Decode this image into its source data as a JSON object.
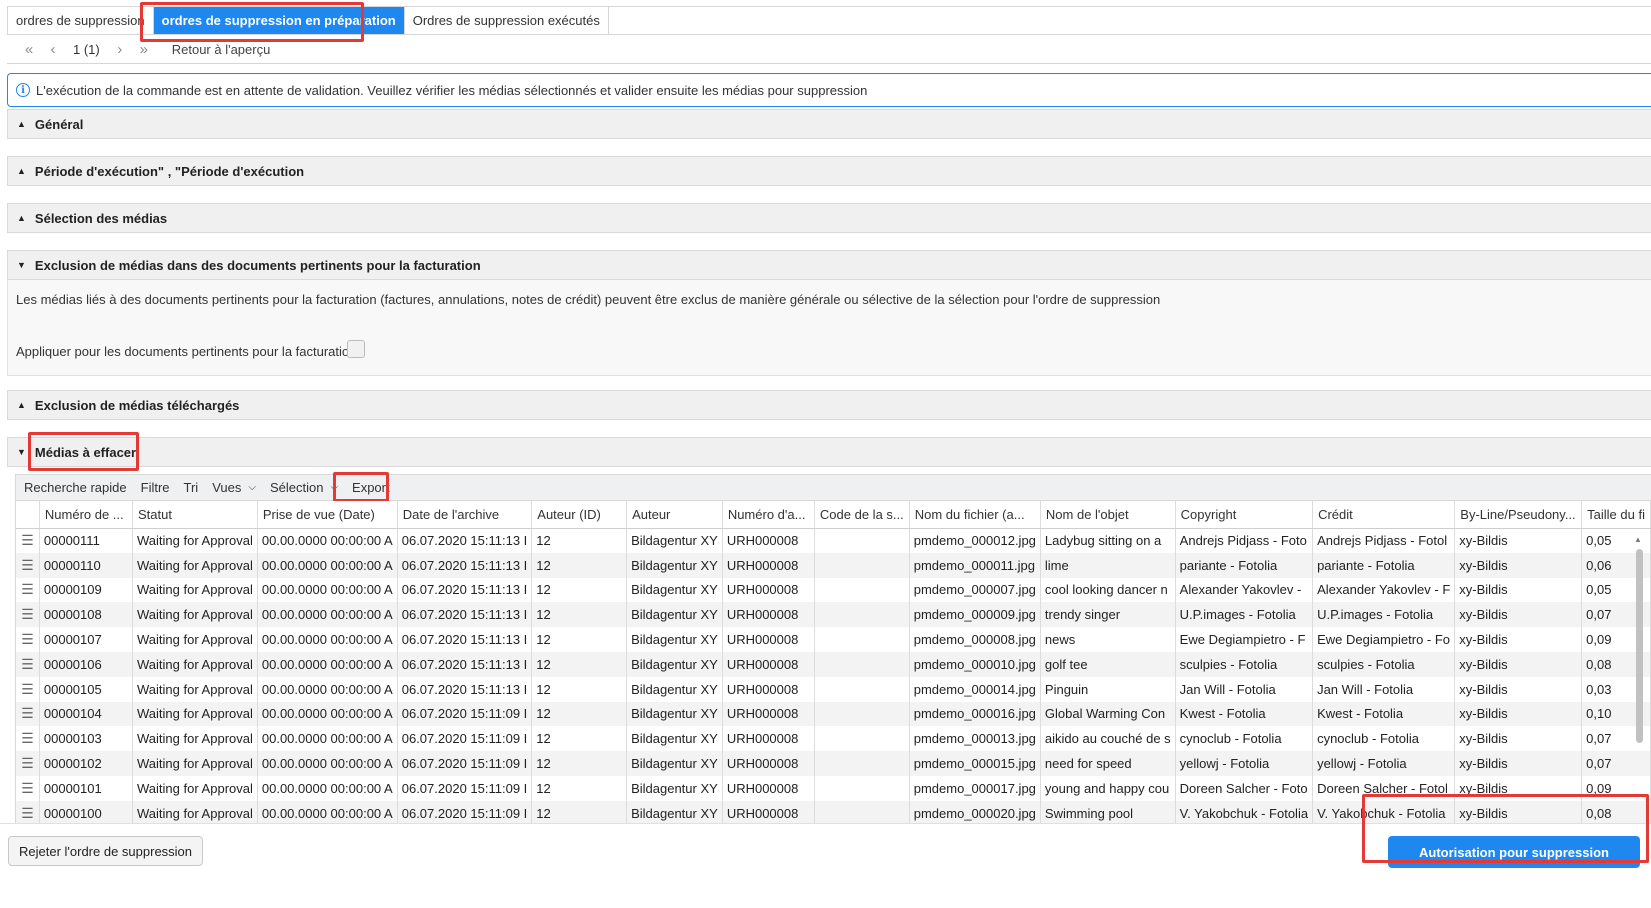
{
  "tabs": [
    {
      "label": "ordres de suppression"
    },
    {
      "label": "ordres de suppression en préparation"
    },
    {
      "label": "Ordres de suppression exécutés"
    }
  ],
  "pager": {
    "page": "1 (1)",
    "back": "Retour à l'aperçu"
  },
  "info": {
    "icon": "info-icon",
    "text": "L'exécution de la commande est en attente de validation. Veuillez vérifier les médias sélectionnés et valider ensuite les médias pour suppression"
  },
  "sections": {
    "general": "Général",
    "periode": "Période d'exécution\" , \"Période d'exécution",
    "selection": "Sélection des médias",
    "exclusion_billing": "Exclusion de médias dans des documents pertinents pour la facturation",
    "exclusion_downloaded": "Exclusion de médias téléchargés",
    "to_delete": "Médias à effacer"
  },
  "exclusion": {
    "description": "Les médias liés à des documents pertinents pour la facturation (factures, annulations, notes de crédit) peuvent être exclus de manière générale ou sélective de la sélection pour l'ordre de suppression",
    "apply_label": "Appliquer pour les documents pertinents pour la facturation:"
  },
  "toolbar": {
    "quick_search": "Recherche rapide",
    "filter": "Filtre",
    "sort": "Tri",
    "views": "Vues",
    "selection": "Sélection",
    "export": "Export"
  },
  "table": {
    "columns": [
      "",
      "Numéro de ...",
      "Statut",
      "Prise de vue (Date)",
      "Date de l'archive",
      "Auteur (ID)",
      "Auteur",
      "Numéro d'a...",
      "Code de la s...",
      "Nom du fichier (a...",
      "Nom de l'objet",
      "Copyright",
      "Crédit",
      "By-Line/Pseudony...",
      "Taille du fi"
    ],
    "rows": [
      [
        "☰",
        "00000111",
        "Waiting for Approval",
        "00.00.0000 00:00:00 A",
        "06.07.2020 15:11:13 I",
        "12",
        "Bildagentur XY",
        "URH000008",
        "",
        "pmdemo_000012.jpg",
        "Ladybug sitting on a",
        "Andrejs Pidjass - Foto",
        "Andrejs Pidjass - Fotol",
        "xy-Bildis",
        "0,05"
      ],
      [
        "☰",
        "00000110",
        "Waiting for Approval",
        "00.00.0000 00:00:00 A",
        "06.07.2020 15:11:13 I",
        "12",
        "Bildagentur XY",
        "URH000008",
        "",
        "pmdemo_000011.jpg",
        "lime",
        "pariante - Fotolia",
        "pariante - Fotolia",
        "xy-Bildis",
        "0,06"
      ],
      [
        "☰",
        "00000109",
        "Waiting for Approval",
        "00.00.0000 00:00:00 A",
        "06.07.2020 15:11:13 I",
        "12",
        "Bildagentur XY",
        "URH000008",
        "",
        "pmdemo_000007.jpg",
        "cool looking dancer n",
        "Alexander Yakovlev -",
        "Alexander Yakovlev - F",
        "xy-Bildis",
        "0,05"
      ],
      [
        "☰",
        "00000108",
        "Waiting for Approval",
        "00.00.0000 00:00:00 A",
        "06.07.2020 15:11:13 I",
        "12",
        "Bildagentur XY",
        "URH000008",
        "",
        "pmdemo_000009.jpg",
        "trendy singer",
        "U.P.images - Fotolia",
        "U.P.images - Fotolia",
        "xy-Bildis",
        "0,07"
      ],
      [
        "☰",
        "00000107",
        "Waiting for Approval",
        "00.00.0000 00:00:00 A",
        "06.07.2020 15:11:13 I",
        "12",
        "Bildagentur XY",
        "URH000008",
        "",
        "pmdemo_000008.jpg",
        "news",
        "Ewe Degiampietro - F",
        "Ewe Degiampietro - Fo",
        "xy-Bildis",
        "0,09"
      ],
      [
        "☰",
        "00000106",
        "Waiting for Approval",
        "00.00.0000 00:00:00 A",
        "06.07.2020 15:11:13 I",
        "12",
        "Bildagentur XY",
        "URH000008",
        "",
        "pmdemo_000010.jpg",
        "golf tee",
        "sculpies - Fotolia",
        "sculpies - Fotolia",
        "xy-Bildis",
        "0,08"
      ],
      [
        "☰",
        "00000105",
        "Waiting for Approval",
        "00.00.0000 00:00:00 A",
        "06.07.2020 15:11:13 I",
        "12",
        "Bildagentur XY",
        "URH000008",
        "",
        "pmdemo_000014.jpg",
        "Pinguin",
        "Jan Will - Fotolia",
        "Jan Will - Fotolia",
        "xy-Bildis",
        "0,03"
      ],
      [
        "☰",
        "00000104",
        "Waiting for Approval",
        "00.00.0000 00:00:00 A",
        "06.07.2020 15:11:09 I",
        "12",
        "Bildagentur XY",
        "URH000008",
        "",
        "pmdemo_000016.jpg",
        "Global Warming Con",
        "Kwest - Fotolia",
        "Kwest - Fotolia",
        "xy-Bildis",
        "0,10"
      ],
      [
        "☰",
        "00000103",
        "Waiting for Approval",
        "00.00.0000 00:00:00 A",
        "06.07.2020 15:11:09 I",
        "12",
        "Bildagentur XY",
        "URH000008",
        "",
        "pmdemo_000013.jpg",
        "aikido au couché de s",
        "cynoclub - Fotolia",
        "cynoclub - Fotolia",
        "xy-Bildis",
        "0,07"
      ],
      [
        "☰",
        "00000102",
        "Waiting for Approval",
        "00.00.0000 00:00:00 A",
        "06.07.2020 15:11:09 I",
        "12",
        "Bildagentur XY",
        "URH000008",
        "",
        "pmdemo_000015.jpg",
        "need for speed",
        "yellowj - Fotolia",
        "yellowj - Fotolia",
        "xy-Bildis",
        "0,07"
      ],
      [
        "☰",
        "00000101",
        "Waiting for Approval",
        "00.00.0000 00:00:00 A",
        "06.07.2020 15:11:09 I",
        "12",
        "Bildagentur XY",
        "URH000008",
        "",
        "pmdemo_000017.jpg",
        "young and happy cou",
        "Doreen Salcher - Foto",
        "Doreen Salcher - Fotol",
        "xy-Bildis",
        "0,09"
      ],
      [
        "☰",
        "00000100",
        "Waiting for Approval",
        "00.00.0000 00:00:00 A",
        "06.07.2020 15:11:09 I",
        "12",
        "Bildagentur XY",
        "URH000008",
        "",
        "pmdemo_000020.jpg",
        "Swimming pool",
        "V. Yakobchuk - Fotolia",
        "V. Yakobchuk - Fotolia",
        "xy-Bildis",
        "0,08"
      ]
    ]
  },
  "footer": {
    "reject": "Rejeter l'ordre de suppression",
    "authorize": "Autorisation pour suppression"
  },
  "colors": {
    "accent": "#1e87f0",
    "highlight": "#e53935"
  }
}
